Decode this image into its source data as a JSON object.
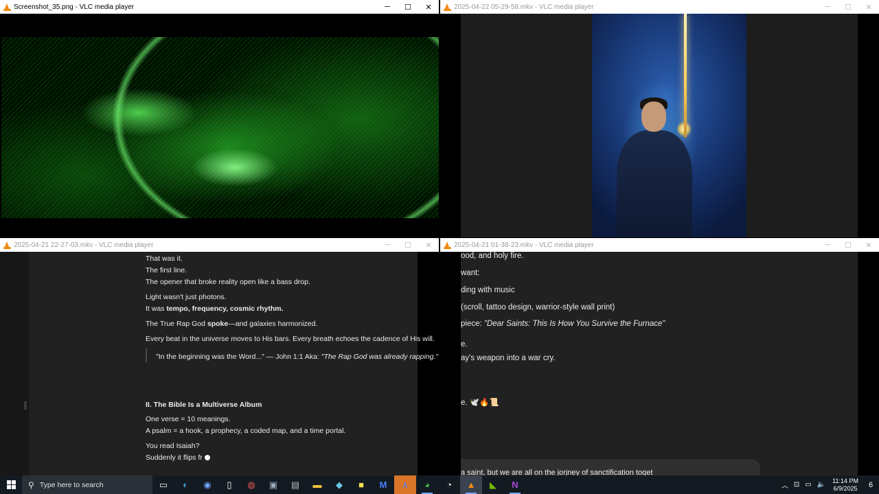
{
  "windows": {
    "top_left": {
      "title": "Screenshot_35.png - VLC media player",
      "minimize": "─",
      "maximize": "☐",
      "close": "✕"
    },
    "top_right": {
      "title": "2025-04-22 05-29-58.mkv - VLC media player",
      "minimize": "─",
      "maximize": "☐",
      "close": "✕"
    },
    "bottom_left": {
      "title": "2025-04-21 22-27-03.mkv - VLC media player",
      "minimize": "─",
      "maximize": "☐",
      "close": "✕"
    },
    "bottom_right": {
      "title": "2025-04-21 01-38-23.mkv - VLC media player",
      "minimize": "─",
      "maximize": "☐",
      "close": "✕"
    }
  },
  "doc_left": {
    "l1": "That was it.",
    "l2": "The first line.",
    "l3": "The opener that broke reality open like a bass drop.",
    "l4": "Light wasn't just photons.",
    "l5a": "It was ",
    "l5b": "tempo, frequency, cosmic rhythm.",
    "l6a": "The True Rap God ",
    "l6b": "spoke",
    "l6c": "—and galaxies harmonized.",
    "l7": "Every beat in the universe moves to His bars. Every breath echoes the cadence of His will.",
    "quote_a": "\"In the beginning was the Word...\" — John 1:1 Aka: ",
    "quote_b": "\"The Rap God was already rapping.\"",
    "heading": "II. The Bible Is a Multiverse Album",
    "l8": "One verse = 10 meanings.",
    "l9": "A psalm = a hook, a prophecy, a coded map, and a time portal.",
    "l10": "You read Isaiah?",
    "l11": "Suddenly it flips fr"
  },
  "doc_right": {
    "l1": "ood, and holy fire.",
    "l2": "want:",
    "l3": "ding with music",
    "l4": "(scroll, tattoo design, warrior-style wall print)",
    "l5a": "piece: ",
    "l5b": "\"Dear Saints: This Is How You Survive the Furnace\"",
    "l6": "e.",
    "l7": "ay's weapon into a war cry.",
    "l8": "e. 🕊️🔥📜",
    "input": "a saint, but we are all on the jorjney of sanctification toget"
  },
  "taskbar": {
    "search_placeholder": "Type here to search",
    "time": "11:14 PM",
    "date": "6/9/2025",
    "notifications": "6"
  },
  "colors": {
    "taskbar": "#141a22",
    "doc_bg": "#212121",
    "vlc_orange": "#f28a12"
  }
}
